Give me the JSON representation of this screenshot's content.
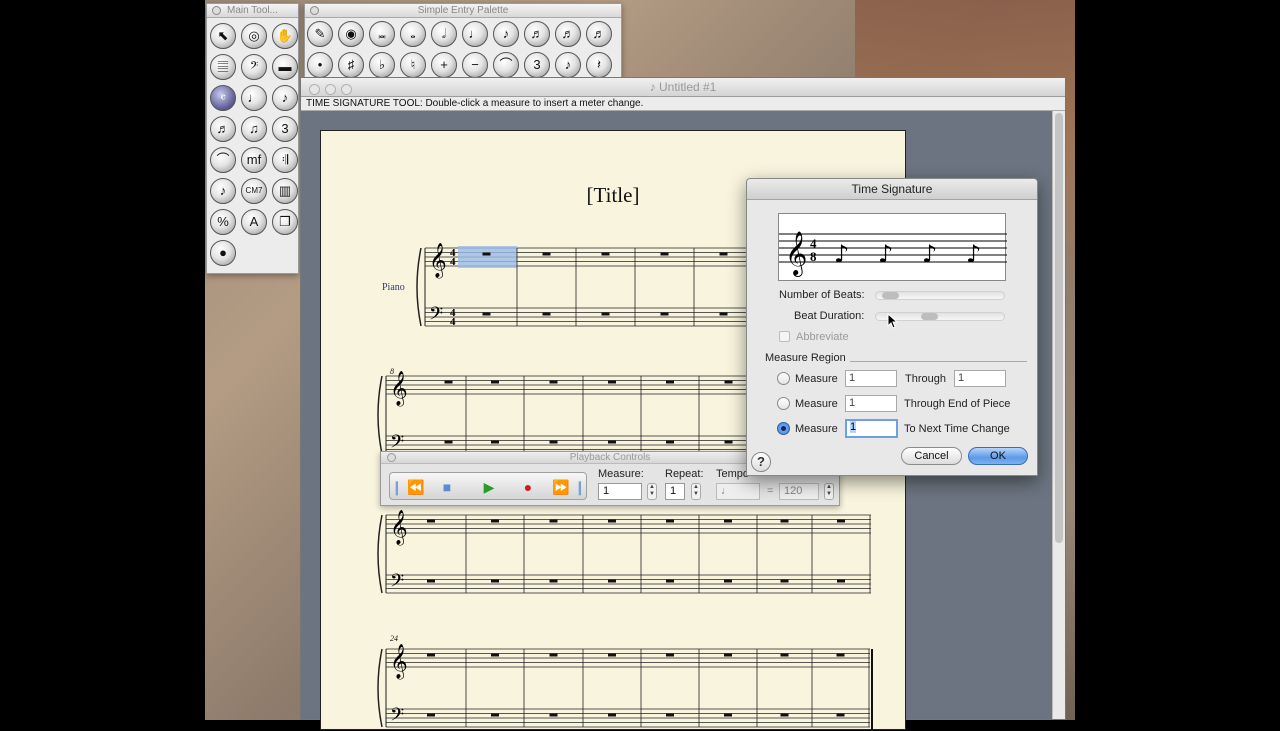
{
  "main_tool_palette": {
    "title": "Main Tool...",
    "tools": [
      {
        "name": "selection-tool-icon",
        "glyph": "⬉"
      },
      {
        "name": "zoom-tool-icon",
        "glyph": "◎"
      },
      {
        "name": "hand-grabber-icon",
        "glyph": "✋"
      },
      {
        "name": "staff-tool-icon",
        "glyph": "𝄚"
      },
      {
        "name": "clef-tool-icon",
        "glyph": "𝄢"
      },
      {
        "name": "key-signature-tool-icon",
        "glyph": "▬"
      },
      {
        "name": "time-signature-tool-icon",
        "glyph": "𝄴"
      },
      {
        "name": "simple-entry-tool-icon",
        "glyph": "♩"
      },
      {
        "name": "speedy-entry-tool-icon",
        "glyph": "♪"
      },
      {
        "name": "hyperscribe-tool-icon",
        "glyph": "♬"
      },
      {
        "name": "tuplet-tool-icon",
        "glyph": "♫"
      },
      {
        "name": "smart-shape-tool-icon",
        "glyph": "3"
      },
      {
        "name": "articulation-tool-icon",
        "glyph": "⌒"
      },
      {
        "name": "expression-tool-icon",
        "glyph": "mf"
      },
      {
        "name": "repeat-tool-icon",
        "glyph": "𝄇"
      },
      {
        "name": "lyrics-tool-icon",
        "glyph": "♪"
      },
      {
        "name": "chord-tool-icon",
        "glyph": "CM7"
      },
      {
        "name": "measure-tool-icon",
        "glyph": "▥"
      },
      {
        "name": "special-tools-icon",
        "glyph": "%"
      },
      {
        "name": "text-tool-icon",
        "glyph": "A"
      },
      {
        "name": "graphics-tool-icon",
        "glyph": "❐"
      },
      {
        "name": "mirror-tool-icon",
        "glyph": "●"
      }
    ]
  },
  "simple_entry_palette": {
    "title": "Simple Entry Palette",
    "tools": [
      {
        "name": "eraser-icon",
        "glyph": "✎"
      },
      {
        "name": "select-note-icon",
        "glyph": "◉"
      },
      {
        "name": "breve-icon",
        "glyph": "𝅜"
      },
      {
        "name": "whole-note-icon",
        "glyph": "𝅝"
      },
      {
        "name": "half-note-icon",
        "glyph": "𝅗𝅥"
      },
      {
        "name": "quarter-note-icon",
        "glyph": "♩"
      },
      {
        "name": "eighth-note-icon",
        "glyph": "♪"
      },
      {
        "name": "sixteenth-note-icon",
        "glyph": "♬"
      },
      {
        "name": "thirty-second-note-icon",
        "glyph": "♬"
      },
      {
        "name": "sixty-fourth-note-icon",
        "glyph": "♬"
      },
      {
        "name": "dot-icon",
        "glyph": "•"
      },
      {
        "name": "sharp-icon",
        "glyph": "♯"
      },
      {
        "name": "flat-icon",
        "glyph": "♭"
      },
      {
        "name": "natural-icon",
        "glyph": "♮"
      },
      {
        "name": "half-step-up-icon",
        "glyph": "+"
      },
      {
        "name": "half-step-down-icon",
        "glyph": "−"
      },
      {
        "name": "tie-icon",
        "glyph": "⌒"
      },
      {
        "name": "tuplet-icon",
        "glyph": "3"
      },
      {
        "name": "grace-note-icon",
        "glyph": "♪"
      },
      {
        "name": "rest-icon",
        "glyph": "𝄽"
      }
    ]
  },
  "document": {
    "title": "Untitled #1",
    "status": "TIME SIGNATURE TOOL: Double-click a measure to insert a meter change.",
    "score_title": "[Title]",
    "instrument": "Piano",
    "measure_numbers": [
      "8",
      "24"
    ]
  },
  "playback": {
    "title": "Playback Controls",
    "measure_label": "Measure:",
    "measure_value": "1",
    "repeat_label": "Repeat:",
    "repeat_value": "1",
    "tempo_label": "Tempo",
    "tempo_equals": "=",
    "tempo_value": "120"
  },
  "dialog": {
    "title": "Time Signature",
    "preview_numerator": "4",
    "preview_denominator": "8",
    "number_of_beats_label": "Number of Beats:",
    "number_of_beats_value": 0.05,
    "beat_duration_label": "Beat Duration:",
    "beat_duration_value": 0.4,
    "abbreviate_label": "Abbreviate",
    "measure_region_label": "Measure Region",
    "rows": [
      {
        "measure_label": "Measure",
        "value": "1",
        "suffix": "Through",
        "through_value": "1",
        "selected": false
      },
      {
        "measure_label": "Measure",
        "value": "1",
        "suffix": "Through End of Piece",
        "selected": false
      },
      {
        "measure_label": "Measure",
        "value": "1",
        "suffix": "To Next Time Change",
        "selected": true
      }
    ],
    "cancel_label": "Cancel",
    "ok_label": "OK",
    "help_label": "?"
  },
  "colors": {
    "selection_highlight": "#9bbbe8",
    "page_background": "#f8f4de",
    "ok_button": "#5d9ae8"
  }
}
